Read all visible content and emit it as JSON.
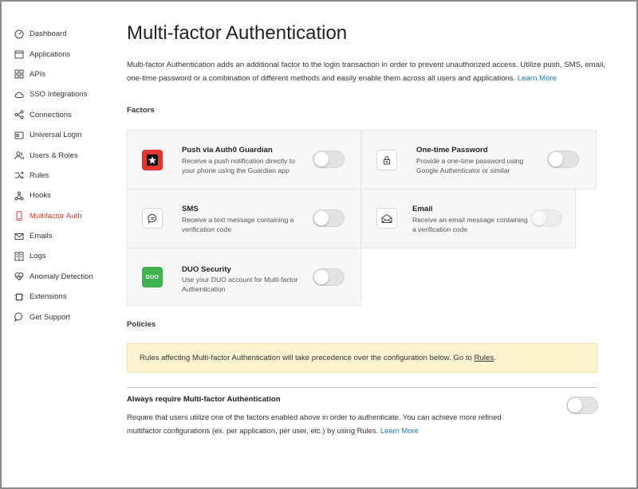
{
  "sidebar": {
    "items": [
      {
        "label": "Dashboard",
        "icon": "dashboard-icon"
      },
      {
        "label": "Applications",
        "icon": "applications-icon"
      },
      {
        "label": "APIs",
        "icon": "apis-icon"
      },
      {
        "label": "SSO Integrations",
        "icon": "cloud-icon"
      },
      {
        "label": "Connections",
        "icon": "connections-icon"
      },
      {
        "label": "Universal Login",
        "icon": "universal-login-icon"
      },
      {
        "label": "Users & Roles",
        "icon": "users-icon"
      },
      {
        "label": "Rules",
        "icon": "rules-icon"
      },
      {
        "label": "Hooks",
        "icon": "hooks-icon"
      },
      {
        "label": "Multifactor Auth",
        "icon": "phone-icon",
        "active": true
      },
      {
        "label": "Emails",
        "icon": "email-icon"
      },
      {
        "label": "Logs",
        "icon": "logs-icon"
      },
      {
        "label": "Anomaly Detection",
        "icon": "heart-icon"
      },
      {
        "label": "Extensions",
        "icon": "extensions-icon"
      },
      {
        "label": "Get Support",
        "icon": "chat-icon"
      }
    ],
    "active_color": "#e5352f"
  },
  "main": {
    "title": "Multi-factor Authentication",
    "intro": "Multi-factor Authentication adds an additional factor to the login transaction in order to prevent unauthorized access. Utilize push, SMS, email, one-time password or a combination of different methods and easily enable them across all users and applications.",
    "intro_link": "Learn More",
    "factors_heading": "Factors",
    "factors": {
      "push": {
        "title": "Push via Auth0 Guardian",
        "desc": "Receive a push notification directly to your phone using the Guardian app",
        "icon": "guardian-star-icon",
        "icon_color": "#e5352f",
        "enabled": false
      },
      "otp": {
        "title": "One-time Password",
        "desc": "Provide a one-time password using Google Authenticator or similar",
        "icon": "lock-icon",
        "enabled": false
      },
      "sms": {
        "title": "SMS",
        "desc": "Receive a text message containing a verification code",
        "icon": "message-bubble-icon",
        "enabled": false
      },
      "email": {
        "title": "Email",
        "desc": "Receive an email message containing a verification code",
        "icon": "envelope-icon",
        "enabled": false
      },
      "duo": {
        "title": "DUO Security",
        "desc": "Use your DUO account for Multi-factor Authentication",
        "icon": "duo-logo-icon",
        "icon_color": "#3fb34f",
        "logo_text": "DUO",
        "enabled": false
      }
    },
    "policies_heading": "Policies",
    "notice": {
      "text": "Rules affecting Multi-factor Authentication will take precedence over the configuration below. Go to",
      "link": "Rules",
      "after": "."
    },
    "policy": {
      "title": "Always require Multi-factor Authentication",
      "desc": "Require that users utilize one of the factors enabled above in order to authenticate. You can achieve more refined multifactor configurations (ex. per application, per user, etc.) by using Rules.",
      "link": "Learn More",
      "enabled": false
    }
  }
}
